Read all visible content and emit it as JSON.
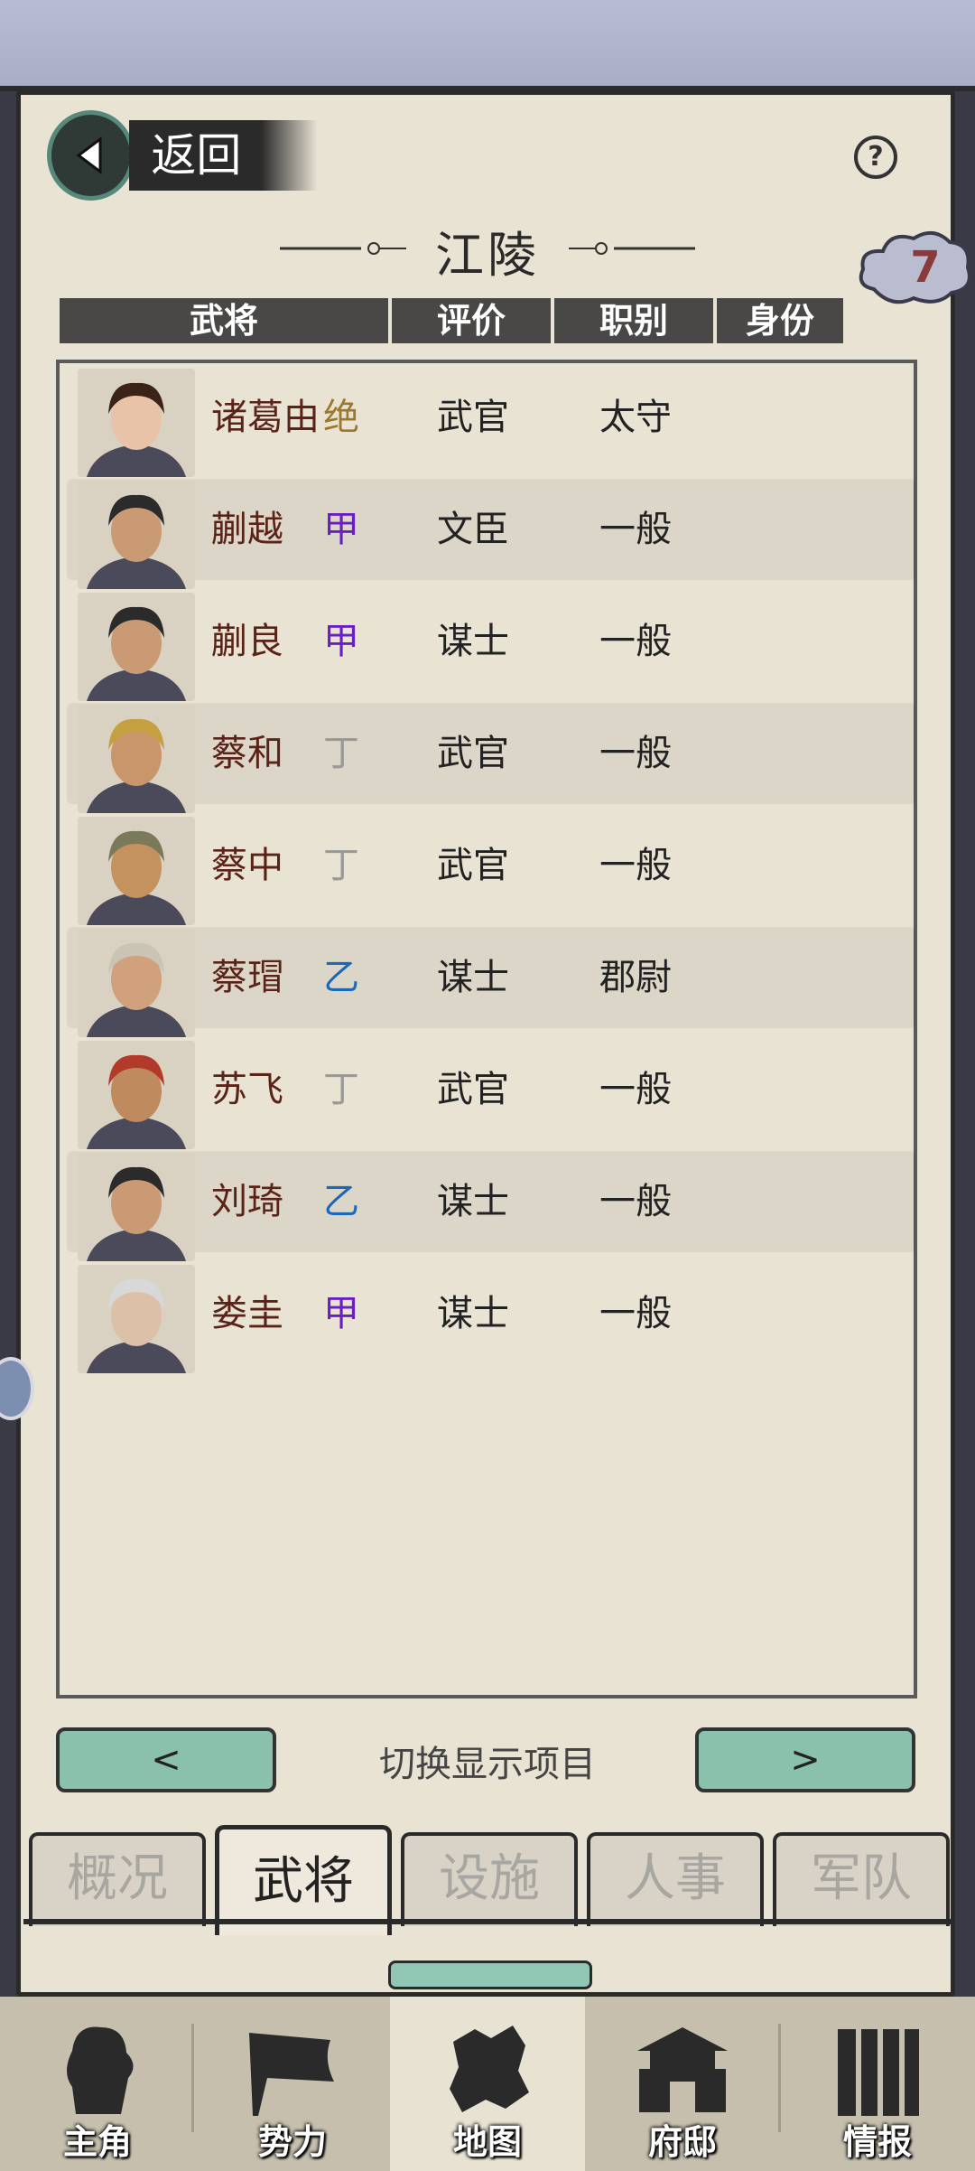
{
  "header": {
    "back_label": "返回",
    "help_label": "?",
    "city_name": "江陵",
    "badge_count": "7"
  },
  "table": {
    "columns": [
      "武将",
      "评价",
      "职别",
      "身份"
    ],
    "rows": [
      {
        "name": "诸葛由",
        "rating": "绝",
        "rating_color": "#9a7a2a",
        "post": "武官",
        "status": "太守"
      },
      {
        "name": "蒯越",
        "rating": "甲",
        "rating_color": "#6a1fc2",
        "post": "文臣",
        "status": "一般"
      },
      {
        "name": "蒯良",
        "rating": "甲",
        "rating_color": "#6a1fc2",
        "post": "谋士",
        "status": "一般"
      },
      {
        "name": "蔡和",
        "rating": "丁",
        "rating_color": "#9a9a9a",
        "post": "武官",
        "status": "一般"
      },
      {
        "name": "蔡中",
        "rating": "丁",
        "rating_color": "#9a9a9a",
        "post": "武官",
        "status": "一般"
      },
      {
        "name": "蔡瑁",
        "rating": "乙",
        "rating_color": "#1a68b8",
        "post": "谋士",
        "status": "郡尉"
      },
      {
        "name": "苏飞",
        "rating": "丁",
        "rating_color": "#9a9a9a",
        "post": "武官",
        "status": "一般"
      },
      {
        "name": "刘琦",
        "rating": "乙",
        "rating_color": "#1a68b8",
        "post": "谋士",
        "status": "一般"
      },
      {
        "name": "娄圭",
        "rating": "甲",
        "rating_color": "#6a1fc2",
        "post": "谋士",
        "status": "一般"
      }
    ]
  },
  "pager": {
    "prev_label": "<",
    "next_label": ">",
    "switch_label": "切换显示项目"
  },
  "tabs": [
    "概况",
    "武将",
    "设施",
    "人事",
    "军队"
  ],
  "active_tab": "武将",
  "bottom_nav": [
    "主角",
    "势力",
    "地图",
    "府邸",
    "情报"
  ],
  "active_nav": "地图"
}
